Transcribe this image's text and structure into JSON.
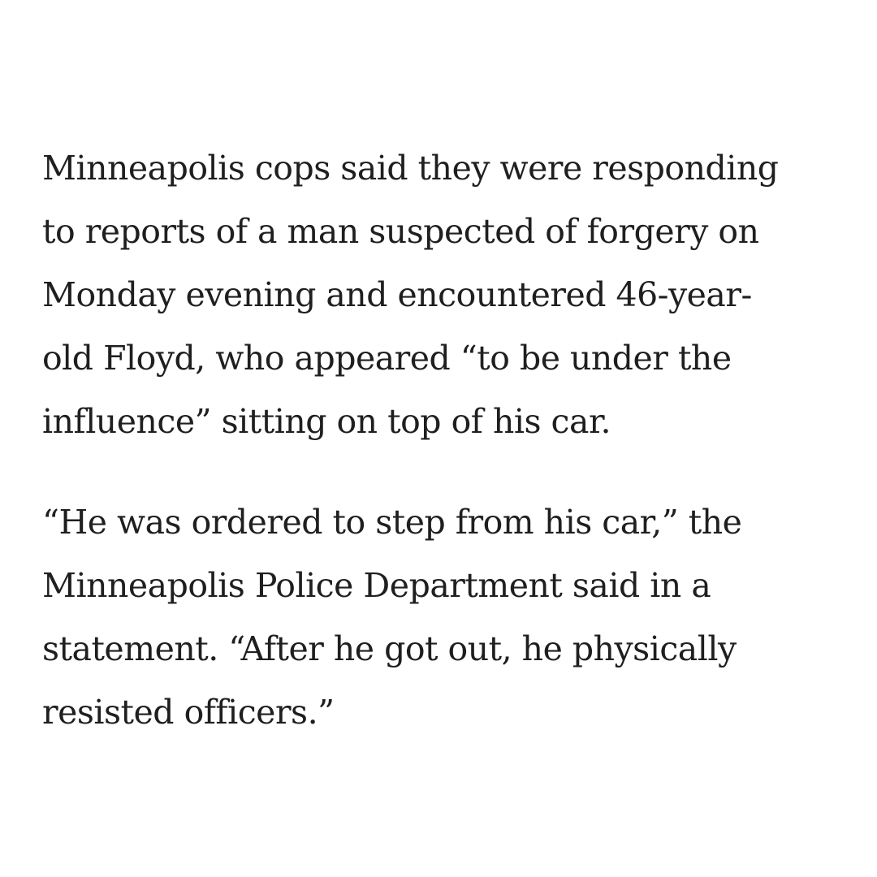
{
  "article": {
    "paragraphs": [
      {
        "lines": [
          "Minneapolis cops said they were responding",
          "to reports of a man suspected of forgery on",
          "Monday evening and encountered 46-year-",
          "old Floyd, who appeared “to be under the",
          "influence” sitting on top of his car."
        ]
      },
      {
        "lines": [
          "“He was ordered to step from his car,” the",
          "Minneapolis Police Department said in a",
          "statement. “After he got out, he physically",
          "resisted officers.”"
        ]
      }
    ]
  }
}
